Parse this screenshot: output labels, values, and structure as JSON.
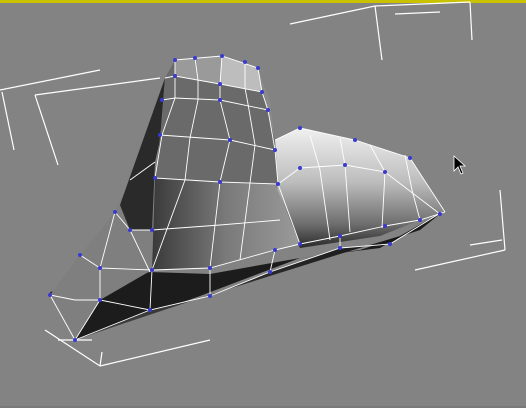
{
  "viewport": {
    "view": "Perspective",
    "shading": "smooth-highlights-edged-faces",
    "background_color": "#838383",
    "active_border_color": "#c9c200",
    "gizmo_color": "#ffffff",
    "mesh_light_color": "#d6d6d6",
    "mesh_dark_color": "#1a1a1a",
    "wire_color": "#ffffff",
    "vertex_color": "#3a3ad0"
  },
  "selection": {
    "subobject_level": "vertex",
    "shows_vertex_ticks": true
  },
  "cursor": {
    "icon": "arrow-cursor-icon"
  }
}
